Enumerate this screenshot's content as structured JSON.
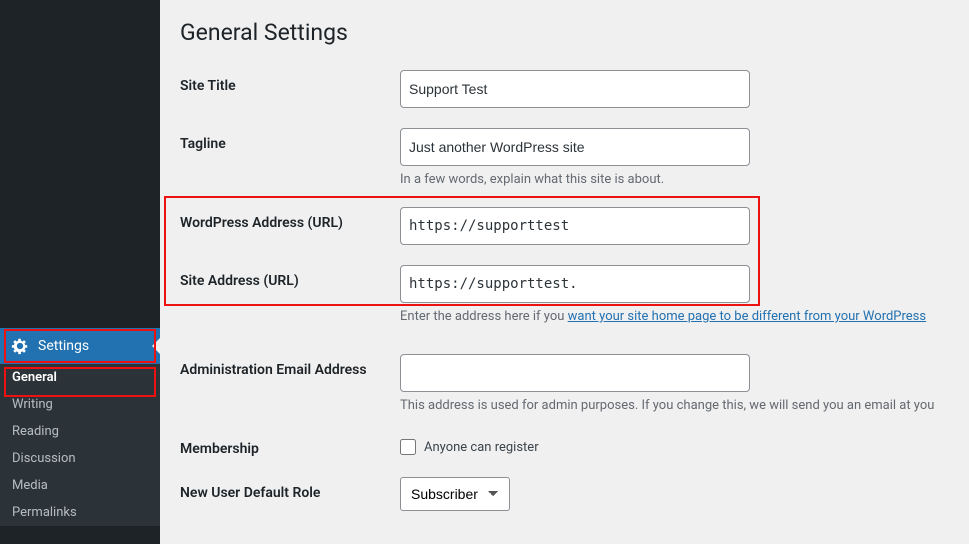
{
  "sidebar": {
    "settings_label": "Settings",
    "items": [
      {
        "label": "General"
      },
      {
        "label": "Writing"
      },
      {
        "label": "Reading"
      },
      {
        "label": "Discussion"
      },
      {
        "label": "Media"
      },
      {
        "label": "Permalinks"
      }
    ]
  },
  "page": {
    "title": "General Settings"
  },
  "fields": {
    "site_title": {
      "label": "Site Title",
      "value": "Support Test"
    },
    "tagline": {
      "label": "Tagline",
      "value": "Just another WordPress site",
      "desc": "In a few words, explain what this site is about."
    },
    "wp_url": {
      "label": "WordPress Address (URL)",
      "value": "https://supporttest"
    },
    "site_url": {
      "label": "Site Address (URL)",
      "value": "https://supporttest.",
      "desc_prefix": "Enter the address here if you ",
      "desc_link": "want your site home page to be different from your WordPress"
    },
    "admin_email": {
      "label": "Administration Email Address",
      "value": "",
      "desc": "This address is used for admin purposes. If you change this, we will send you an email at you"
    },
    "membership": {
      "label": "Membership",
      "checkbox_label": "Anyone can register"
    },
    "default_role": {
      "label": "New User Default Role",
      "value": "Subscriber"
    }
  }
}
